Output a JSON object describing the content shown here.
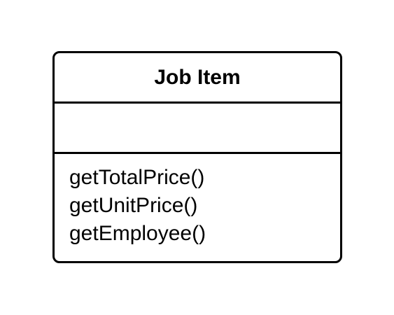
{
  "class_box": {
    "name": "Job Item",
    "attributes": [],
    "operations": [
      "getTotalPrice()",
      "getUnitPrice()",
      "getEmployee()"
    ]
  },
  "colors": {
    "stroke": "#000000",
    "fill": "#ffffff",
    "text": "#000000"
  }
}
